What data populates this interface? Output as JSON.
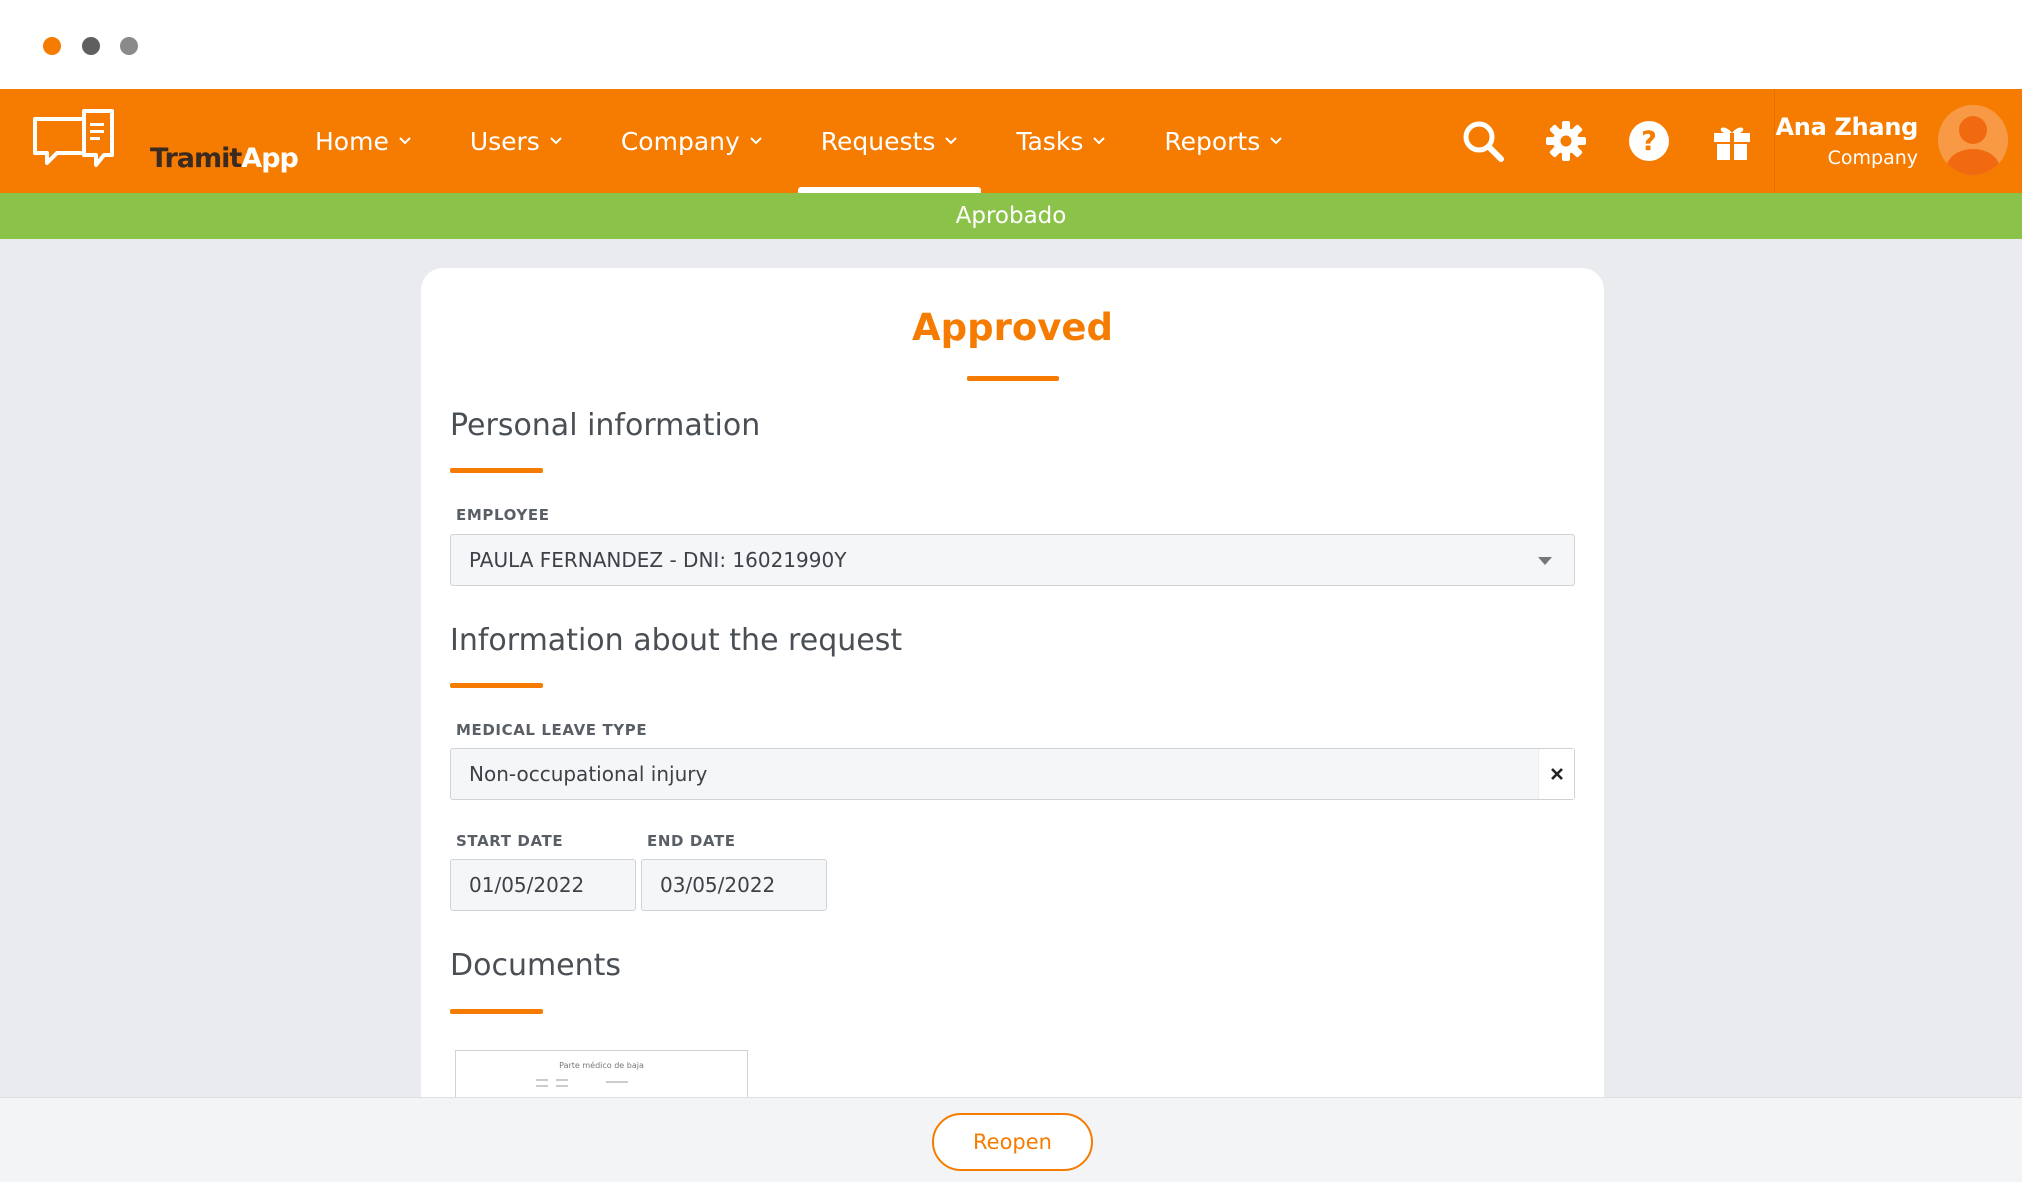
{
  "window": {
    "dots": [
      "#f57c00",
      "#5f5f5f",
      "#8a8a8a"
    ]
  },
  "brand": {
    "name_part1": "Tramit",
    "name_part2": "App",
    "color": "#f57c00"
  },
  "nav": {
    "items": [
      {
        "label": "Home",
        "active": false
      },
      {
        "label": "Users",
        "active": false
      },
      {
        "label": "Company",
        "active": false
      },
      {
        "label": "Requests",
        "active": true
      },
      {
        "label": "Tasks",
        "active": false
      },
      {
        "label": "Reports",
        "active": false
      }
    ],
    "icons": [
      "search-icon",
      "gear-icon",
      "help-icon",
      "gift-icon"
    ]
  },
  "user": {
    "name": "Ana Zhang",
    "role": "Company"
  },
  "status": {
    "label": "Aprobado",
    "color": "#8bc34a"
  },
  "card": {
    "title": "Approved",
    "sections": {
      "personal": {
        "heading": "Personal information",
        "employee_label": "EMPLOYEE",
        "employee_value": "PAULA FERNANDEZ - DNI: 16021990Y"
      },
      "request": {
        "heading": "Information about the request",
        "leave_type_label": "MEDICAL LEAVE TYPE",
        "leave_type_value": "Non-occupational injury",
        "start_label": "START DATE",
        "start_value": "01/05/2022",
        "end_label": "END DATE",
        "end_value": "03/05/2022"
      },
      "documents": {
        "heading": "Documents",
        "doc_title": "Parte médico de baja"
      }
    }
  },
  "footer": {
    "reopen_label": "Reopen"
  }
}
